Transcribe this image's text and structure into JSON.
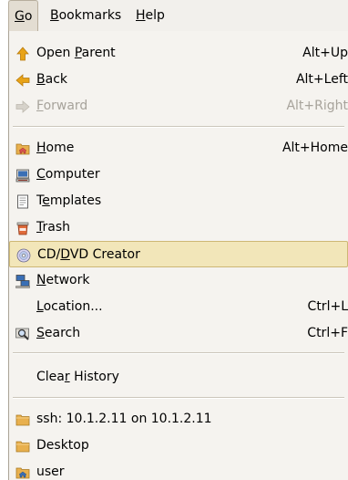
{
  "menubar": {
    "items": [
      {
        "label_mnemonic": "G",
        "label_rest": "o",
        "active": true
      },
      {
        "label_mnemonic": "B",
        "label_rest": "ookmarks",
        "active": false
      },
      {
        "label_mnemonic": "H",
        "label_rest": "elp",
        "active": false
      }
    ]
  },
  "menu": {
    "open_parent": {
      "pre": "Open ",
      "mn": "P",
      "post": "arent",
      "accel": "Alt+Up",
      "icon": "up-arrow-icon"
    },
    "back": {
      "pre": "",
      "mn": "B",
      "post": "ack",
      "accel": "Alt+Left",
      "icon": "back-arrow-icon"
    },
    "forward": {
      "pre": "",
      "mn": "F",
      "post": "orward",
      "accel": "Alt+Right",
      "icon": "forward-arrow-icon"
    },
    "home": {
      "pre": "",
      "mn": "H",
      "post": "ome",
      "accel": "Alt+Home",
      "icon": "home-folder-icon"
    },
    "computer": {
      "pre": "",
      "mn": "C",
      "post": "omputer",
      "accel": "",
      "icon": "computer-icon"
    },
    "templates": {
      "pre": "T",
      "mn": "e",
      "post": "mplates",
      "accel": "",
      "icon": "templates-icon"
    },
    "trash": {
      "pre": "",
      "mn": "T",
      "post": "rash",
      "accel": "",
      "icon": "trash-icon"
    },
    "cd_dvd_creator": {
      "pre": "CD/",
      "mn": "D",
      "post": "VD Creator",
      "accel": "",
      "icon": "cd-icon"
    },
    "network": {
      "pre": "",
      "mn": "N",
      "post": "etwork",
      "accel": "",
      "icon": "network-icon"
    },
    "location": {
      "pre": "",
      "mn": "L",
      "post": "ocation...",
      "accel": "Ctrl+L",
      "icon": ""
    },
    "search": {
      "pre": "",
      "mn": "S",
      "post": "earch",
      "accel": "Ctrl+F",
      "icon": "search-icon"
    },
    "clear_history": {
      "pre": "Clea",
      "mn": "r",
      "post": " History",
      "accel": "",
      "icon": ""
    },
    "ssh": {
      "label": "ssh: 10.1.2.11 on 10.1.2.11",
      "icon": "folder-icon"
    },
    "desktop": {
      "label": "Desktop",
      "icon": "folder-icon"
    },
    "user": {
      "label": "user",
      "icon": "home-folder-icon"
    }
  },
  "colors": {
    "highlight_bg": "#f2e6b9",
    "menu_bg": "#f5f3ef",
    "folder": "#e8b04e",
    "arrow": "#e8a317"
  }
}
